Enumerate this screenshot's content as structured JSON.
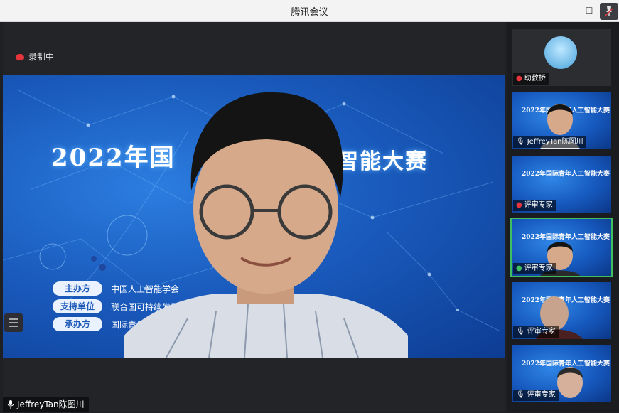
{
  "window": {
    "title": "腾讯会议"
  },
  "stage": {
    "recording_label": "录制中",
    "speaker_name": "JeffreyTan陈图川",
    "slide": {
      "title_left": "2022年国",
      "title_right": "智能大赛",
      "orgs": [
        {
          "label": "主办方",
          "value": "中国人工智能学会"
        },
        {
          "label": "支持单位",
          "value": "联合国可持续发展目"
        },
        {
          "label": "承办方",
          "value": "国际青年人"
        }
      ]
    }
  },
  "sidebar": {
    "tiles": [
      {
        "name": "助教桥",
        "kind": "avatar"
      },
      {
        "name": "JeffreyTan陈图川",
        "kind": "video",
        "slide_title": "2022年国际青年人工智能大赛"
      },
      {
        "name": "评审专家",
        "kind": "slide",
        "slide_title": "2022年国际青年人工智能大赛"
      },
      {
        "name": "评审专家",
        "kind": "video",
        "slide_title": "2022年国际青年人工智能大赛",
        "active": true
      },
      {
        "name": "评审专家",
        "kind": "video",
        "slide_title": "2022年国际青年人工智能大赛"
      },
      {
        "name": "评审专家",
        "kind": "video",
        "slide_title": "2022年国际青年人工智能大赛"
      }
    ]
  },
  "colors": {
    "accent_active": "#3fbf5f",
    "recording": "#e5343a",
    "slide_blue": "#1a5bbd"
  }
}
